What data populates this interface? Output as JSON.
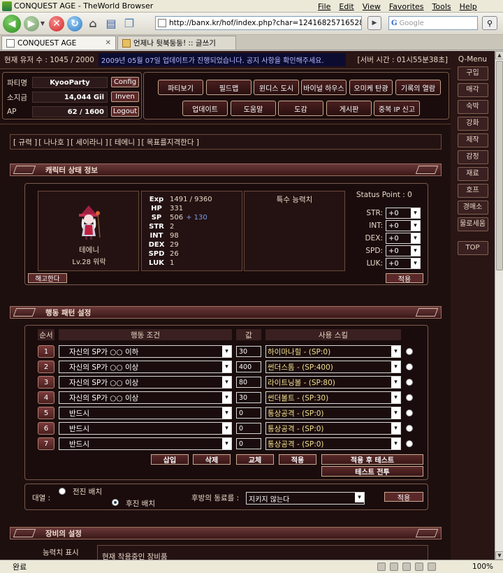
{
  "browser": {
    "window_title": "CONQUEST AGE - TheWorld Browser",
    "menus": [
      "File",
      "Edit",
      "View",
      "Favorites",
      "Tools",
      "Help"
    ],
    "url": "http://banx.kr/hof/index.php?char=1241682571652869",
    "search_placeholder": "Google",
    "tabs": [
      {
        "label": "CONQUEST AGE",
        "active": true
      },
      {
        "label": "언제나 뒷북둥둥! :: 글쓰기",
        "active": false
      }
    ],
    "status_text": "완료",
    "zoom": "100%"
  },
  "top": {
    "users": "현재 유저 수 : 1045 / 2000",
    "notice": "2009년 05월 07일 업데이트가 진행되었습니다. 공지 사항을 확인해주세요.",
    "server_time": "[서버 시간 : 01시55분38초]"
  },
  "party": {
    "party_label": "파티명",
    "party_name": "KyooParty",
    "gold_label": "소지금",
    "gold": "14,044 Gil",
    "ap_label": "AP",
    "ap": "62 / 1600",
    "config_btn": "Config",
    "inven_btn": "Inven",
    "logout_btn": "Logout"
  },
  "main_menu": {
    "row1": [
      "파티보기",
      "필드맵",
      "윈디스 도시",
      "바이널 하우스",
      "오미케 탄광",
      "기록의 열람"
    ],
    "row2": [
      "업데이트",
      "도움말",
      "도감",
      "게시판",
      "중복 IP 신고"
    ]
  },
  "qmenu": {
    "title": "Q-Menu",
    "items": [
      "구입",
      "매각",
      "숙박",
      "강화",
      "제작",
      "감정",
      "재료",
      "호프",
      "경매소",
      "물로세움"
    ],
    "top_btn": "TOP"
  },
  "breadcrumb": [
    "[ 규력 ]",
    "[ 나나호 ]",
    "[ 세이라니 ]",
    "[ 테에니 ]",
    "[ 목표를지격한다 ]"
  ],
  "sections": {
    "char_status": "캐릭터 상태 정보",
    "pattern": "행동 패턴 설정",
    "equipment": "장비의 설정"
  },
  "character": {
    "name": "테에니",
    "level": "Lv.28 워락",
    "fire_btn": "해고한다",
    "stats": [
      {
        "key": "Exp",
        "value": "1491 / 9360",
        "bonus": ""
      },
      {
        "key": "HP",
        "value": "331",
        "bonus": ""
      },
      {
        "key": "SP",
        "value": "506",
        "bonus": "+ 130"
      },
      {
        "key": "STR",
        "value": "2",
        "bonus": ""
      },
      {
        "key": "INT",
        "value": "98",
        "bonus": ""
      },
      {
        "key": "DEX",
        "value": "29",
        "bonus": ""
      },
      {
        "key": "SPD",
        "value": "26",
        "bonus": ""
      },
      {
        "key": "LUK",
        "value": "1",
        "bonus": ""
      }
    ],
    "special_title": "특수 능력치",
    "status_point": "Status Point : 0",
    "alloc": [
      {
        "label": "STR:",
        "value": "+0"
      },
      {
        "label": "INT:",
        "value": "+0"
      },
      {
        "label": "DEX:",
        "value": "+0"
      },
      {
        "label": "SPD:",
        "value": "+0"
      },
      {
        "label": "LUK:",
        "value": "+0"
      }
    ],
    "apply_btn": "적용"
  },
  "pattern": {
    "headers": {
      "order": "순서",
      "condition": "행동 조건",
      "value": "값",
      "skill": "사용 스킬"
    },
    "rows": [
      {
        "n": "1",
        "cond": "자신의 SP가 ○○ 이하",
        "val": "30",
        "skill": "하이마나힐 - (SP:0)"
      },
      {
        "n": "2",
        "cond": "자신의 SP가 ○○ 이상",
        "val": "400",
        "skill": "썬더스톰 - (SP:400)"
      },
      {
        "n": "3",
        "cond": "자신의 SP가 ○○ 이상",
        "val": "80",
        "skill": "라이트닝볼 - (SP:80)"
      },
      {
        "n": "4",
        "cond": "자신의 SP가 ○○ 이상",
        "val": "30",
        "skill": "썬더볼트 - (SP:30)"
      },
      {
        "n": "5",
        "cond": "반드시",
        "val": "0",
        "skill": "통상공격 - (SP:0)"
      },
      {
        "n": "6",
        "cond": "반드시",
        "val": "0",
        "skill": "통상공격 - (SP:0)"
      },
      {
        "n": "7",
        "cond": "반드시",
        "val": "0",
        "skill": "통상공격 - (SP:0)"
      }
    ],
    "buttons": {
      "insert": "삽입",
      "delete": "삭제",
      "swap": "교체",
      "apply": "적용",
      "apply_test": "적용 후 테스트",
      "test_battle": "테스트 전투"
    }
  },
  "formation": {
    "label": "대열 :",
    "front": "전진 배치",
    "back": "후진 배치",
    "rear_label": "후방의 동료를 :",
    "rear_value": "지키지 않는다",
    "apply_btn": "적용"
  },
  "equipment": {
    "stat_label": "능력치 표시",
    "current_label": "현재 착용중인 장비품"
  }
}
